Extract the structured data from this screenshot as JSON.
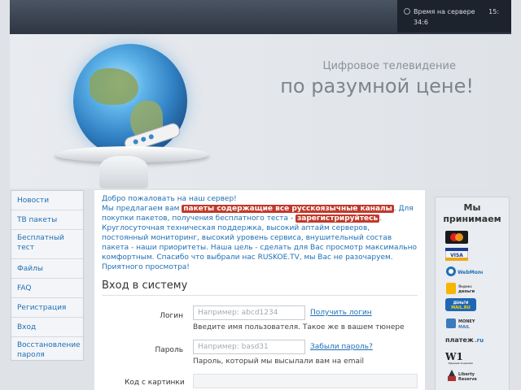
{
  "header": {
    "server_time_label": "Время на сервере",
    "server_time": "15: 34:6"
  },
  "banner": {
    "line1": "Цифровое телевидение",
    "line2": "по разумной цене!"
  },
  "nav": {
    "items": [
      {
        "label": "Новости"
      },
      {
        "label": "ТВ пакеты"
      },
      {
        "label": "Бесплатный тест"
      },
      {
        "label": "Файлы"
      },
      {
        "label": "FAQ"
      },
      {
        "label": "Регистрация"
      },
      {
        "label": "Вход"
      },
      {
        "label": "Восстановление пароля"
      }
    ]
  },
  "intro": {
    "line1": "Добро пожаловать на наш сервер!",
    "offer_prefix": "Мы предлагаем вам",
    "offer_highlight": "пакеты содержащие все русскоязычные каналы",
    "offer_suffix": ". Для покупки пакетов, получения бесплатного теста -",
    "register_highlight": "зарегистрируйтесь",
    "support_text": ". Круглосуточная техническая поддержка, высокий аптайм серверов, постоянный мониторинг, высокий уровень сервиса, внушительный состав пакета - наши приоритеты. Наша цель - сделать для Вас просмотр максимально комфортным. Спасибо что выбрали нас RUSKOE.TV, мы Вас не разочаруем.",
    "closing": "Приятного просмотра!"
  },
  "login": {
    "title": "Вход в систему",
    "login_label": "Логин",
    "login_placeholder": "Например: abcd1234",
    "login_link": "Получить логин",
    "login_help": "Введите имя пользователя. Такое же в вашем тюнере",
    "password_label": "Пароль",
    "password_placeholder": "Например: basd31",
    "password_link": "Забыли пароль?",
    "password_help": "Пароль, который мы высылали вам на email",
    "captcha_label": "Код с картинки"
  },
  "payments": {
    "title": "Мы принимаем",
    "methods": [
      {
        "name": "MasterCard",
        "icon": "mastercard-icon"
      },
      {
        "name": "VISA",
        "icon": "visa-icon"
      },
      {
        "name": "WebMoney",
        "icon": "webmoney-icon"
      },
      {
        "name": "Яндекс деньги",
        "icon": "yandex-money-icon"
      },
      {
        "name": "Деньги Mail.ru",
        "icon": "mailru-money-icon"
      },
      {
        "name": "MONEY MAIL",
        "icon": "moneymail-icon"
      },
      {
        "name": "платёж.ru",
        "icon": "platezh-icon"
      },
      {
        "name": "Единый кошелёк",
        "icon": "w1-icon"
      },
      {
        "name": "Liberty Reserve",
        "icon": "liberty-reserve-icon"
      }
    ]
  },
  "colors": {
    "link": "#1f6fb5",
    "highlight": "#c0392b",
    "topbar": "#3a4350"
  }
}
